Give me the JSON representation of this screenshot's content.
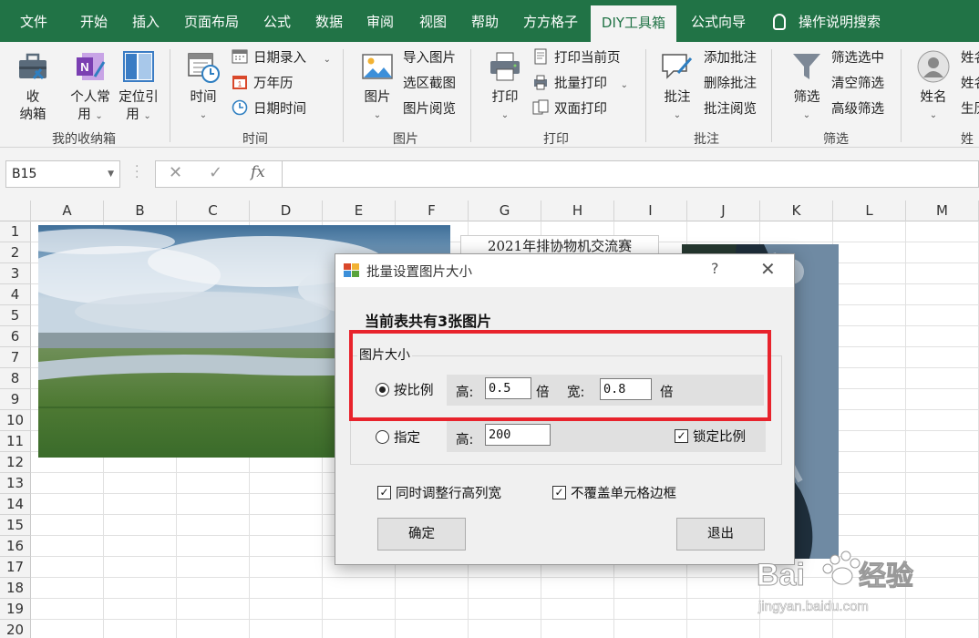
{
  "tabs": [
    {
      "label": "文件",
      "active": false
    },
    {
      "label": "开始",
      "active": false
    },
    {
      "label": "插入",
      "active": false
    },
    {
      "label": "页面布局",
      "active": false
    },
    {
      "label": "公式",
      "active": false
    },
    {
      "label": "数据",
      "active": false
    },
    {
      "label": "审阅",
      "active": false
    },
    {
      "label": "视图",
      "active": false
    },
    {
      "label": "帮助",
      "active": false
    },
    {
      "label": "方方格子",
      "active": false
    },
    {
      "label": "DIY工具箱",
      "active": true
    },
    {
      "label": "公式向导",
      "active": false
    }
  ],
  "search_tab": "操作说明搜索",
  "ribbon": {
    "groups": {
      "storage": "我的收纳箱",
      "time": "时间",
      "image": "图片",
      "print": "打印",
      "comment": "批注",
      "filter": "筛选",
      "name": "姓"
    },
    "storage": {
      "box_line1": "收",
      "box_line2": "纳箱",
      "personal_line1": "个人常",
      "personal_line2": "用",
      "locate_line1": "定位引",
      "locate_line2": "用"
    },
    "time": {
      "big": "时间",
      "date_entry": "日期录入",
      "calendar": "万年历",
      "datetime": "日期时间"
    },
    "image": {
      "big": "图片",
      "import": "导入图片",
      "screenshot": "选区截图",
      "browse": "图片阅览"
    },
    "print": {
      "big": "打印",
      "current_page": "打印当前页",
      "batch": "批量打印",
      "duplex": "双面打印"
    },
    "comment": {
      "big": "批注",
      "add": "添加批注",
      "delete": "删除批注",
      "browse": "批注阅览"
    },
    "filter": {
      "big": "筛选",
      "selected": "筛选选中",
      "clear": "清空筛选",
      "advanced": "高级筛选"
    },
    "name": {
      "big": "姓名",
      "item1": "姓名",
      "item2": "姓名",
      "item3": "生历"
    }
  },
  "formula_bar": {
    "cell_ref": "B15",
    "fx": "fx",
    "formula": ""
  },
  "columns": [
    "A",
    "B",
    "C",
    "D",
    "E",
    "F",
    "G",
    "H",
    "I",
    "J",
    "K",
    "L",
    "M"
  ],
  "rows": [
    "1",
    "2",
    "3",
    "4",
    "5",
    "6",
    "7",
    "8",
    "9",
    "10",
    "11",
    "12",
    "13",
    "14",
    "15",
    "16",
    "17",
    "18",
    "19",
    "20"
  ],
  "cell_title": "2021年排协物机交流赛",
  "dialog": {
    "title": "批量设置图片大小",
    "help": "?",
    "close": "✕",
    "count_text": "当前表共有3张图片",
    "group_label": "图片大小",
    "ratio": {
      "label": "按比例",
      "selected": true,
      "height_label": "高:",
      "height_value": "0.5",
      "height_unit": "倍",
      "width_label": "宽:",
      "width_value": "0.8",
      "width_unit": "倍"
    },
    "fixed": {
      "label": "指定",
      "selected": false,
      "height_label": "高:",
      "height_value": "200",
      "lock_label": "锁定比例",
      "lock_checked": true
    },
    "adjust_rows_label": "同时调整行高列宽",
    "adjust_rows_checked": true,
    "no_cover_label": "不覆盖单元格边框",
    "no_cover_checked": true,
    "ok_label": "确定",
    "exit_label": "退出"
  },
  "watermark": {
    "brand": "Bai",
    "brand_tail": "经验",
    "url": "jingyan.baidu.com"
  },
  "colors": {
    "excel_green": "#217346",
    "highlight_red": "#e8232c"
  }
}
